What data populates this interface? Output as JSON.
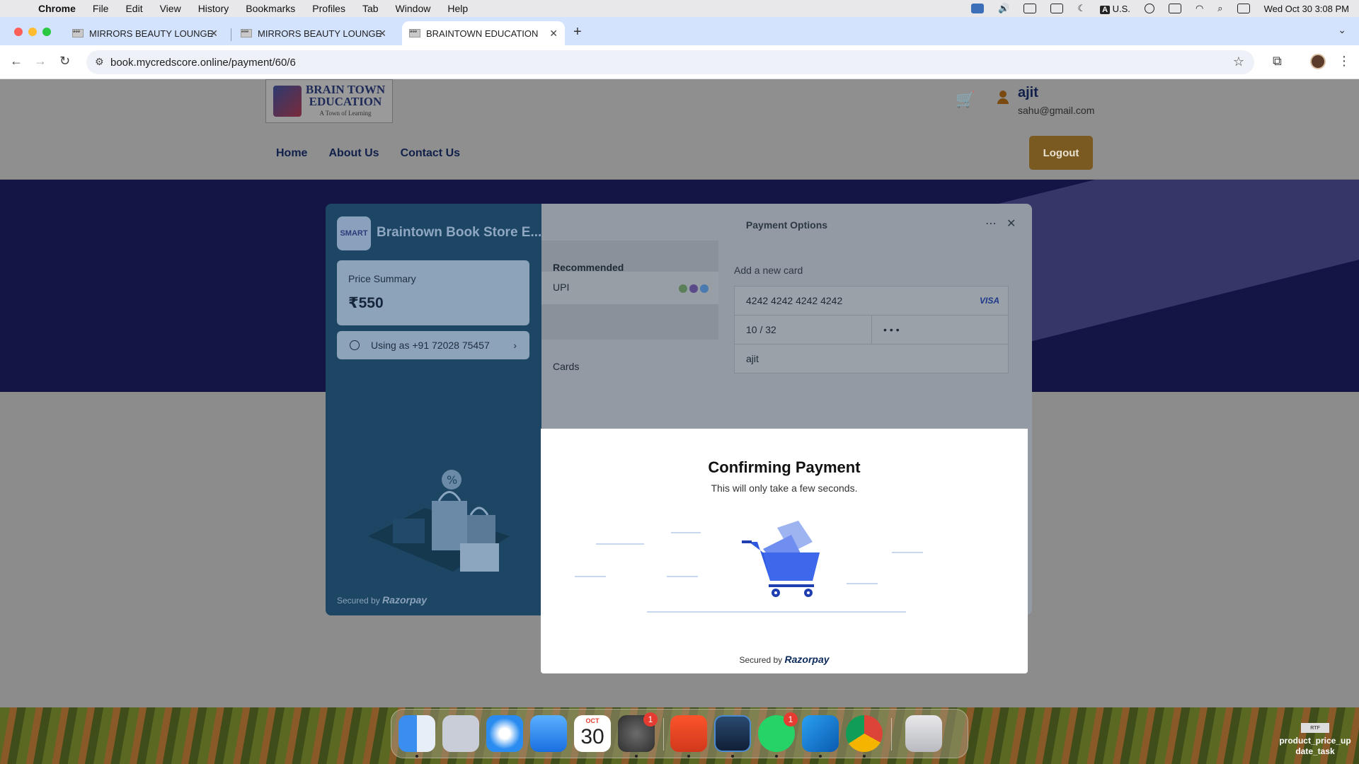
{
  "menubar": {
    "app": "Chrome",
    "items": [
      "File",
      "Edit",
      "View",
      "History",
      "Bookmarks",
      "Profiles",
      "Tab",
      "Window",
      "Help"
    ],
    "input_source": "U.S.",
    "input_badge": "A",
    "datetime": "Wed Oct 30  3:08 PM"
  },
  "browser": {
    "tabs": [
      {
        "title": "MIRRORS BEAUTY LOUNGE",
        "favicon": "ǝǝǝ"
      },
      {
        "title": "MIRRORS BEAUTY LOUNGE",
        "favicon": "ǝǝǝ"
      },
      {
        "title": "BRAINTOWN EDUCATION",
        "favicon": "ǝǝǝ"
      }
    ],
    "url": "book.mycredscore.online/payment/60/6"
  },
  "site": {
    "logo_line1": "BRAIN TOWN",
    "logo_line2": "EDUCATION",
    "logo_tagline": "A Town of Learning",
    "user_name": "ajit",
    "user_email": "sahu@gmail.com",
    "nav": [
      "Home",
      "About Us",
      "Contact Us"
    ],
    "logout_label": "Logout"
  },
  "razorpay": {
    "brand_logo_text": "SMART",
    "brand_name": "Braintown Book Store E...",
    "price_label": "Price Summary",
    "price_value": "₹550",
    "using_as": "Using as +91 72028 75457",
    "left_footer_prefix": "Secured by",
    "left_footer_brand": "Razorpay",
    "title": "Payment Options",
    "menu": {
      "recommended": "Recommended",
      "upi": "UPI",
      "cards": "Cards"
    },
    "add_card_label": "Add a new card",
    "card_number": "4242 4242 4242 4242",
    "card_network": "VISA",
    "expiry": "10 / 32",
    "cvv": "•••",
    "card_name": "ajit"
  },
  "confirm": {
    "title": "Confirming Payment",
    "subtitle": "This will only take a few seconds.",
    "footer_prefix": "Secured by",
    "footer_brand": "Razorpay"
  },
  "dock": {
    "calendar_month": "OCT",
    "calendar_day": "30",
    "settings_badge": "1",
    "whatsapp_badge": "1"
  },
  "desktop": {
    "file_thumb": "RTF",
    "file_name": "product_price_up date_task"
  }
}
